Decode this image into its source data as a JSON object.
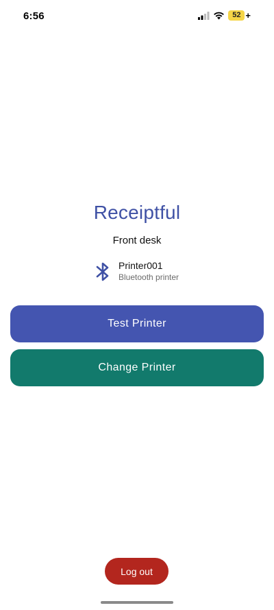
{
  "status_bar": {
    "time": "6:56",
    "battery_level": "52",
    "battery_charging_symbol": "+",
    "signal_icon": "cellular-signal-icon",
    "wifi_icon": "wifi-icon"
  },
  "app": {
    "title": "Receiptful",
    "location": "Front desk"
  },
  "printer": {
    "icon": "bluetooth-icon",
    "name": "Printer001",
    "type": "Bluetooth printer"
  },
  "actions": {
    "test_label": "Test Printer",
    "change_label": "Change Printer",
    "logout_label": "Log out"
  },
  "colors": {
    "title": "#3f51a5",
    "test_button": "#4455b0",
    "change_button": "#127a6c",
    "logout_button": "#b3261e",
    "bluetooth_icon": "#3f51a5",
    "battery": "#f5d547"
  }
}
